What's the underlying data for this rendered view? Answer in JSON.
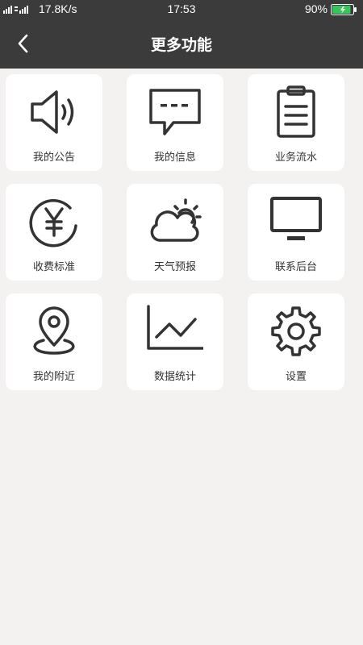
{
  "status_bar": {
    "net_speed": "17.8K/s",
    "time": "17:53",
    "battery": "90%",
    "battery_level": 0.9,
    "battery_color": "#35c759"
  },
  "nav": {
    "title": "更多功能",
    "back_icon": "chevron-left-icon"
  },
  "colors": {
    "header_bg": "#3b3b3b",
    "page_bg": "#f4f1f1",
    "tile_bg": "#ffffff",
    "icon": "#333333"
  },
  "features": [
    {
      "label": "我的公告",
      "icon": "speaker-icon"
    },
    {
      "label": "我的信息",
      "icon": "message-icon"
    },
    {
      "label": "业务流水",
      "icon": "clipboard-icon"
    },
    {
      "label": "收费标准",
      "icon": "yen-icon"
    },
    {
      "label": "天气预报",
      "icon": "weather-icon"
    },
    {
      "label": "联系后台",
      "icon": "monitor-icon"
    },
    {
      "label": "我的附近",
      "icon": "location-pin-icon"
    },
    {
      "label": "数据统计",
      "icon": "line-chart-icon"
    },
    {
      "label": "设置",
      "icon": "gear-icon"
    }
  ]
}
